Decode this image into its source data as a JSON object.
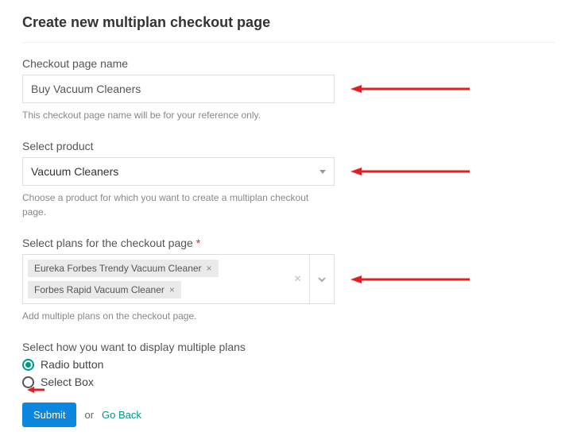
{
  "title": "Create new multiplan checkout page",
  "fields": {
    "name": {
      "label": "Checkout page name",
      "value": "Buy Vacuum Cleaners",
      "help": "This checkout page name will be for your reference only."
    },
    "product": {
      "label": "Select product",
      "value": "Vacuum Cleaners",
      "help": "Choose a product for which you want to create a multiplan checkout page."
    },
    "plans": {
      "label": "Select plans for the checkout page",
      "required_mark": "*",
      "tags": [
        "Eureka Forbes Trendy Vacuum Cleaner",
        "Forbes Rapid Vacuum Cleaner"
      ],
      "help": "Add multiple plans on the checkout page."
    },
    "display": {
      "label": "Select how you want to display multiple plans",
      "options": {
        "radio": "Radio button",
        "select": "Select Box"
      },
      "selected": "radio"
    }
  },
  "actions": {
    "submit": "Submit",
    "or": "or",
    "goback": "Go Back"
  }
}
